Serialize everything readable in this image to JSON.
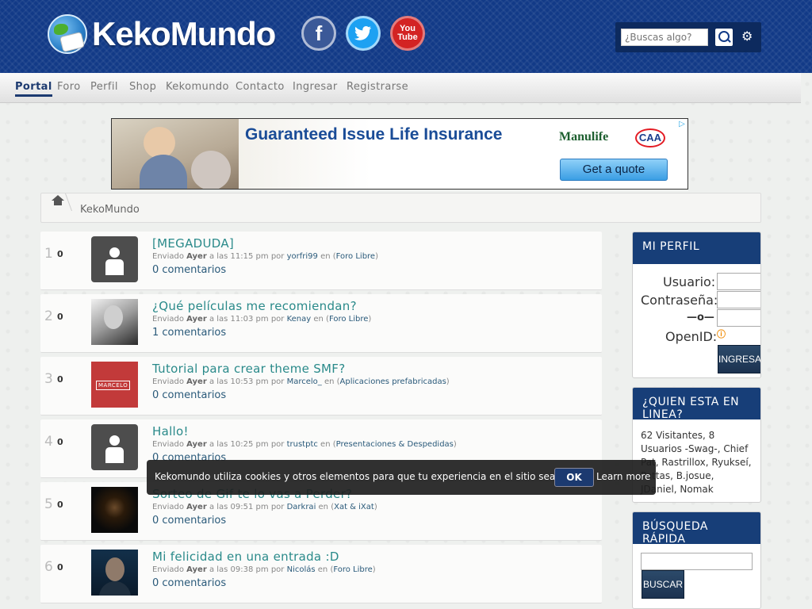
{
  "header": {
    "logo_text": "KekoMundo",
    "social": {
      "facebook": "f",
      "twitter": "t",
      "youtube": "You Tube"
    },
    "search_placeholder": "¿Buscas algo?"
  },
  "nav": [
    "Portal",
    "Foro",
    "Perfil",
    "Shop",
    "Kekomundo",
    "Contacto",
    "Ingresar",
    "Registrarse"
  ],
  "ad": {
    "title": "Guaranteed Issue Life Insurance",
    "brand1": "Manulife",
    "brand2": "CAA",
    "cta": "Get a quote"
  },
  "breadcrumb": {
    "current": "KekoMundo"
  },
  "posts": [
    {
      "num": "1",
      "count": "0",
      "title": "[MEGADUDA]",
      "prefix": "Enviado",
      "day": "Ayer",
      "time": "a las 11:15 pm por",
      "user": "yorfri99",
      "board": "Foro Libre",
      "comments": "0 comentarios"
    },
    {
      "num": "2",
      "count": "0",
      "title": "¿Qué películas me recomiendan?",
      "prefix": "Enviado",
      "day": "Ayer",
      "time": "a las 11:03 pm por",
      "user": "Kenay",
      "board": "Foro Libre",
      "comments": "1 comentarios"
    },
    {
      "num": "3",
      "count": "0",
      "title": "Tutorial para crear theme SMF?",
      "prefix": "Enviado",
      "day": "Ayer",
      "time": "a las 10:53 pm por",
      "user": "Marcelo_",
      "board": "Aplicaciones prefabricadas",
      "comments": "0 comentarios"
    },
    {
      "num": "4",
      "count": "0",
      "title": "Hallo!",
      "prefix": "Enviado",
      "day": "Ayer",
      "time": "a las 10:25 pm por",
      "user": "trustptc",
      "board": "Presentaciones & Despedidas",
      "comments": "0 comentarios"
    },
    {
      "num": "5",
      "count": "0",
      "title": "Sorteo de Gif te lo vas a Perder?",
      "prefix": "Enviado",
      "day": "Ayer",
      "time": "a las 09:51 pm por",
      "user": "Darkrai",
      "board": "Xat & iXat",
      "comments": "0 comentarios"
    },
    {
      "num": "6",
      "count": "0",
      "title": "Mi felicidad en una entrada :D",
      "prefix": "Enviado",
      "day": "Ayer",
      "time": "a las 09:38 pm por",
      "user": "Nicolás",
      "board": "Foro Libre",
      "comments": "0 comentarios"
    }
  ],
  "sidebar": {
    "profile": {
      "title": "MI PERFIL",
      "user_label": "Usuario:",
      "pass_label": "Contraseña:",
      "or_label": "—o—",
      "openid_label": "OpenID:",
      "login_button": "INGRESAR"
    },
    "online": {
      "title": "¿QUIEN ESTA EN LINEA?",
      "text": "62 Visitantes, 8 Usuarios -Swag-, Chief Pat, Rastrillox, Ryukseí, Pattas, B.josue, JDaniel, Nomak"
    },
    "quick_search": {
      "title": "BÚSQUEDA RÁPIDA",
      "button": "BUSCAR"
    }
  },
  "cookie": {
    "text": "Kekomundo utiliza cookies y otros elementos para que tu experiencia en el sitio sea mejor",
    "ok": "OK",
    "more": "Learn more"
  }
}
